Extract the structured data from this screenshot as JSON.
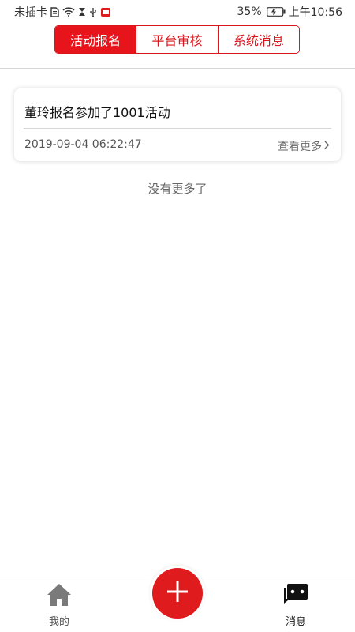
{
  "status_bar": {
    "carrier": "未插卡",
    "battery": "35%",
    "time": "上午10:56"
  },
  "tabs": [
    {
      "label": "活动报名",
      "active": true
    },
    {
      "label": "平台审核",
      "active": false
    },
    {
      "label": "系统消息",
      "active": false
    }
  ],
  "messages": [
    {
      "title": "董玲报名参加了1001活动",
      "time": "2019-09-04 06:22:47",
      "more": "查看更多"
    }
  ],
  "list_end_text": "没有更多了",
  "bottom_nav": {
    "mine_label": "我的",
    "messages_label": "消息"
  },
  "colors": {
    "accent": "#e8141b"
  }
}
